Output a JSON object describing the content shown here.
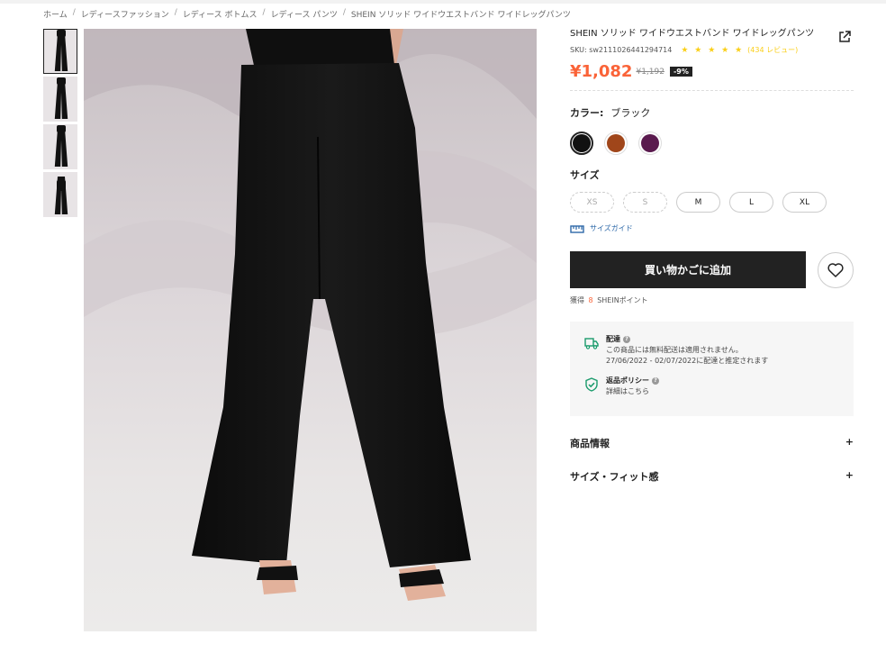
{
  "breadcrumb": {
    "items": [
      "ホーム",
      "レディースファッション",
      "レディース ボトムス",
      "レディース パンツ",
      "SHEIN ソリッド ワイドウエストバンド ワイドレッグパンツ"
    ],
    "separators": [
      "/",
      "/",
      "/",
      "/"
    ]
  },
  "product": {
    "title": "SHEIN ソリッド ワイドウエストバンド ワイドレッグパンツ",
    "sku": "SKU: sw2111026441294714",
    "stars": "★ ★ ★ ★ ★",
    "rating": 4.5,
    "reviews": "(434 レビュー)",
    "price": "¥1,082",
    "old_price": "¥1,192",
    "discount": "-9%"
  },
  "color": {
    "label": "カラー:",
    "value": "ブラック",
    "swatches": [
      {
        "name": "black",
        "hex": "#111111",
        "selected": true
      },
      {
        "name": "brown",
        "hex": "#a0461a",
        "selected": false
      },
      {
        "name": "purple",
        "hex": "#5a1a4e",
        "selected": false
      }
    ]
  },
  "size": {
    "label": "サイズ",
    "options": [
      {
        "label": "XS",
        "available": false
      },
      {
        "label": "S",
        "available": false
      },
      {
        "label": "M",
        "available": true
      },
      {
        "label": "L",
        "available": true
      },
      {
        "label": "XL",
        "available": true
      }
    ],
    "guide": "サイズガイド"
  },
  "cart": {
    "add_label": "買い物かごに追加",
    "points_prefix": "獲得",
    "points_value": "8",
    "points_suffix": "SHEINポイント"
  },
  "shipping": {
    "title": "配達",
    "line1": "この商品には無料配送は適用されません。",
    "line2": "27/06/2022 - 02/07/2022に配達と推定されます",
    "return_title": "返品ポリシー",
    "return_text": "詳細はこちら"
  },
  "accordions": [
    {
      "label": "商品情報",
      "icon": "+"
    },
    {
      "label": "サイズ・フィット感",
      "icon": "+"
    }
  ],
  "colors": {
    "accent_price": "#fa6338",
    "star": "#facf19",
    "link": "#2d68a8",
    "shield": "#1a9b6c"
  }
}
